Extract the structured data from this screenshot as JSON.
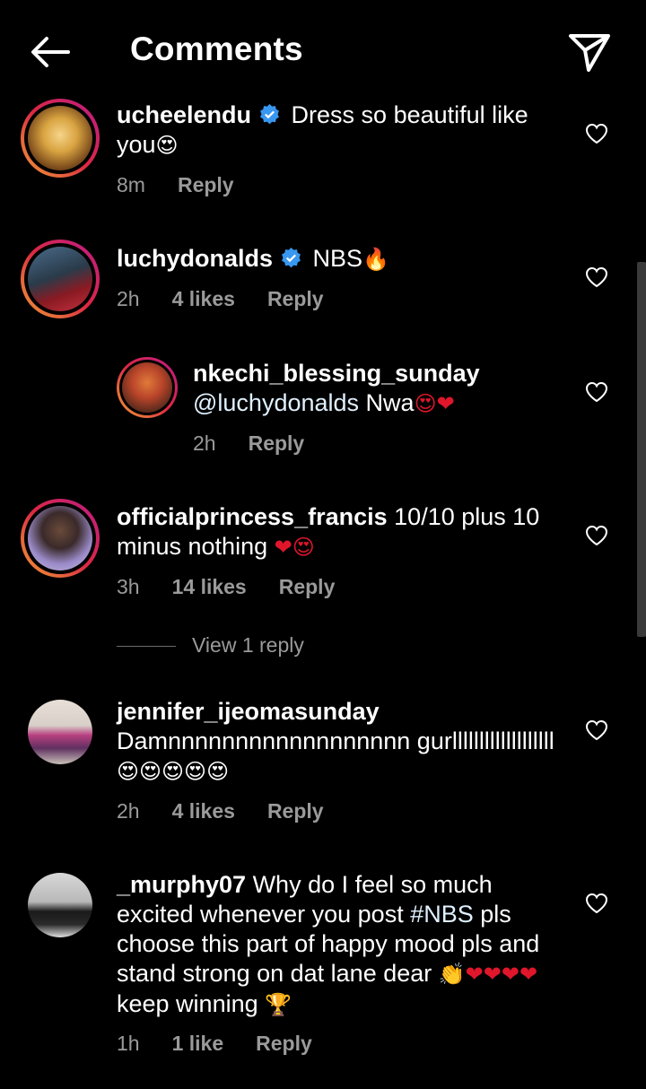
{
  "header": {
    "title": "Comments",
    "back_icon": "arrow-left-icon",
    "share_icon": "paper-plane-icon"
  },
  "comments": [
    {
      "username": "ucheelendu",
      "verified": true,
      "text": "Dress so beautiful like you",
      "emoji": "😍",
      "time": "8m",
      "likes": "",
      "reply_label": "Reply"
    },
    {
      "username": "luchydonalds",
      "verified": true,
      "text": "NBS",
      "emoji": "🔥",
      "time": "2h",
      "likes": "4 likes",
      "reply_label": "Reply"
    },
    {
      "username": "nkechi_blessing_sunday",
      "verified": false,
      "mention": "@luchydonalds",
      "text": "Nwa",
      "emoji": "😍❤",
      "time": "2h",
      "likes": "",
      "reply_label": "Reply"
    },
    {
      "username": "officialprincess_francis",
      "verified": false,
      "text": "10/10 plus 10 minus nothing",
      "emoji": "❤😍",
      "time": "3h",
      "likes": "14 likes",
      "reply_label": "Reply"
    },
    {
      "username": "jennifer_ijeomasunday",
      "verified": false,
      "text": "Damnnnnnnnnnnnnnnnnnn gurlllllllllllllllllll",
      "emoji": "😍😍😍😍😍",
      "time": "2h",
      "likes": "4 likes",
      "reply_label": "Reply"
    },
    {
      "username": "_murphy07",
      "verified": false,
      "text_a": "Why do I feel so much excited whenever you post",
      "hashtag": "#NBS",
      "text_b": "pls choose this part of happy mood pls and stand strong on dat lane dear",
      "emoji_a": "👏❤❤❤❤",
      "text_c": "keep winning",
      "emoji_b": "🏆",
      "time": "1h",
      "likes": "1 like",
      "reply_label": "Reply"
    }
  ],
  "view_replies": "View 1 reply",
  "colors": {
    "background": "#000000",
    "meta": "#9a9a9a",
    "verified": "#3897f0",
    "heart_red": "#e0162b"
  }
}
